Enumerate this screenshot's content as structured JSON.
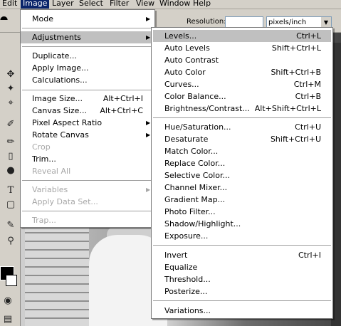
{
  "menubar": [
    "Edit",
    "Image",
    "Layer",
    "Select",
    "Filter",
    "View",
    "Window",
    "Help"
  ],
  "options_bar": {
    "resolution_label": "Resolution:",
    "resolution_value": "",
    "units_value": "pixels/inch"
  },
  "image_menu": {
    "mode": "Mode",
    "adjustments": "Adjustments",
    "duplicate": "Duplicate...",
    "apply_image": "Apply Image...",
    "calculations": "Calculations...",
    "image_size": {
      "label": "Image Size...",
      "shortcut": "Alt+Ctrl+I"
    },
    "canvas_size": {
      "label": "Canvas Size...",
      "shortcut": "Alt+Ctrl+C"
    },
    "pixel_aspect_ratio": "Pixel Aspect Ratio",
    "rotate_canvas": "Rotate Canvas",
    "crop": "Crop",
    "trim": "Trim...",
    "reveal_all": "Reveal All",
    "variables": "Variables",
    "apply_data_set": "Apply Data Set...",
    "trap": "Trap..."
  },
  "adjustments_menu": [
    {
      "label": "Levels...",
      "shortcut": "Ctrl+L"
    },
    {
      "label": "Auto Levels",
      "shortcut": "Shift+Ctrl+L"
    },
    {
      "label": "Auto Contrast",
      "shortcut": ""
    },
    {
      "label": "Auto Color",
      "shortcut": "Shift+Ctrl+B"
    },
    {
      "label": "Curves...",
      "shortcut": "Ctrl+M"
    },
    {
      "label": "Color Balance...",
      "shortcut": "Ctrl+B"
    },
    {
      "label": "Brightness/Contrast...",
      "shortcut": "Alt+Shift+Ctrl+L"
    },
    {
      "label": "Hue/Saturation...",
      "shortcut": "Ctrl+U"
    },
    {
      "label": "Desaturate",
      "shortcut": "Shift+Ctrl+U"
    },
    {
      "label": "Match Color...",
      "shortcut": ""
    },
    {
      "label": "Replace Color...",
      "shortcut": ""
    },
    {
      "label": "Selective Color...",
      "shortcut": ""
    },
    {
      "label": "Channel Mixer...",
      "shortcut": ""
    },
    {
      "label": "Gradient Map...",
      "shortcut": ""
    },
    {
      "label": "Photo Filter...",
      "shortcut": ""
    },
    {
      "label": "Shadow/Highlight...",
      "shortcut": ""
    },
    {
      "label": "Exposure...",
      "shortcut": ""
    },
    {
      "label": "Invert",
      "shortcut": "Ctrl+I"
    },
    {
      "label": "Equalize",
      "shortcut": ""
    },
    {
      "label": "Threshold...",
      "shortcut": ""
    },
    {
      "label": "Posterize...",
      "shortcut": ""
    },
    {
      "label": "Variations...",
      "shortcut": ""
    }
  ],
  "colors": {
    "menu_active": "#0a246a",
    "highlight": "#c0c0c0",
    "disabled": "#a7a7a7"
  }
}
